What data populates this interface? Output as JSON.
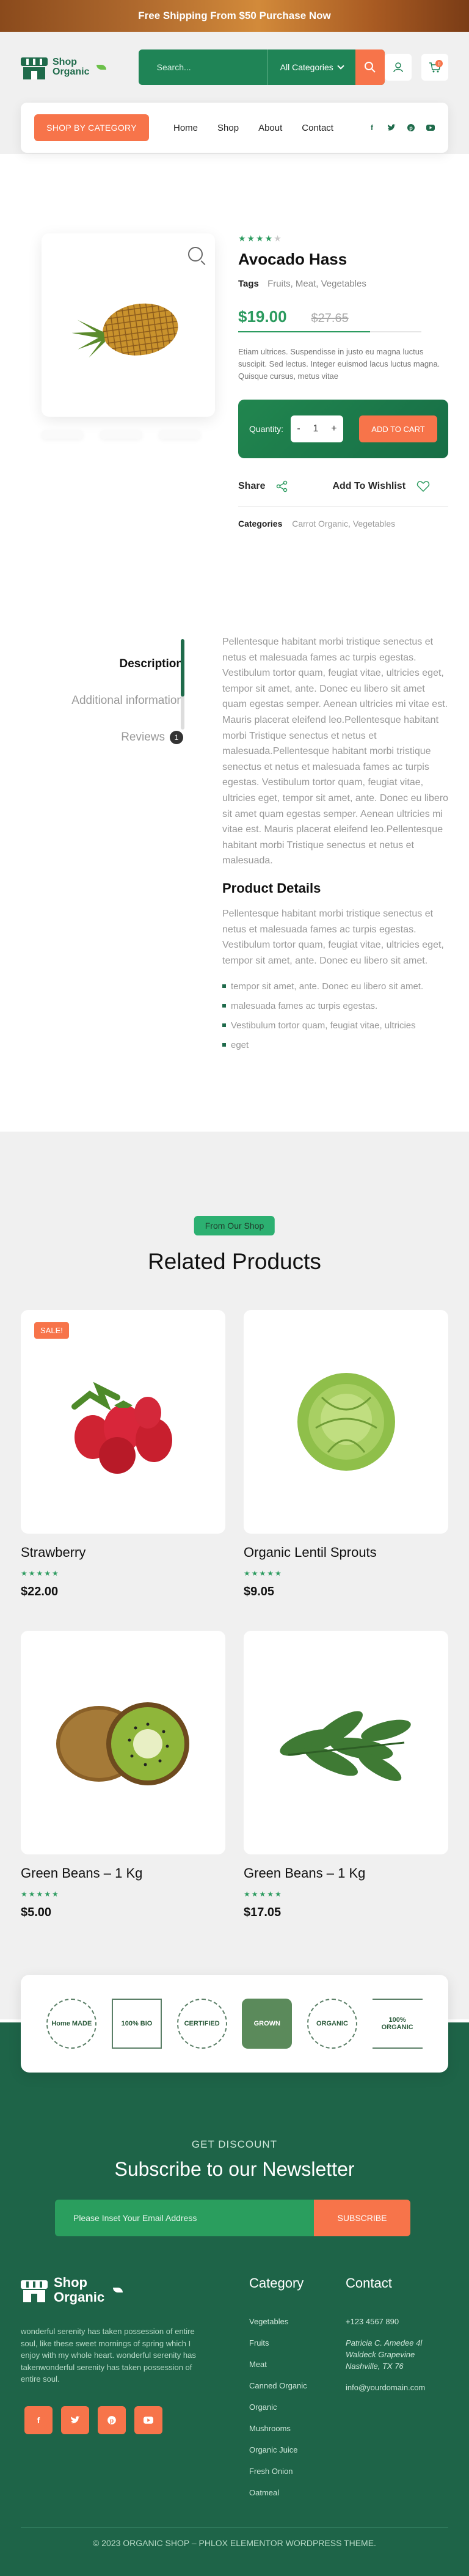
{
  "topbar": {
    "text": "Free Shipping From $50 Purchase Now"
  },
  "header": {
    "logo_line1": "Shop",
    "logo_line2": "Organic",
    "search_placeholder": "Search...",
    "category_select": "All Categories",
    "cart_count": "0"
  },
  "nav": {
    "shop_by_category": "SHOP BY CATEGORY",
    "links": [
      "Home",
      "Shop",
      "About",
      "Contact"
    ],
    "social_icons": [
      "facebook-icon",
      "twitter-icon",
      "pinterest-icon",
      "youtube-icon"
    ]
  },
  "product": {
    "rating": "4",
    "title": "Avocado Hass",
    "tags_label": "Tags",
    "tags": "Fruits, Meat, Vegetables",
    "price": "$19.00",
    "old_price": "$27.65",
    "description": "Etiam ultrices. Suspendisse in justo eu magna luctus suscipit. Sed lectus. Integer euismod lacus luctus magna. Quisque cursus, metus vitae",
    "quantity_label": "Quantity:",
    "quantity_value": "1",
    "add_to_cart": "ADD TO CART",
    "share": "Share",
    "wishlist": "Add To Wishlist",
    "categories_label": "Categories",
    "categories": "Carrot Organic, Vegetables"
  },
  "tabs": {
    "items": [
      "Description",
      "Additional information",
      "Reviews"
    ],
    "review_count": "1",
    "body_p1": "Pellentesque habitant morbi tristique senectus et netus et malesuada fames ac turpis egestas. Vestibulum tortor quam, feugiat vitae, ultricies eget, tempor sit amet, ante. Donec eu libero sit amet quam egestas semper. Aenean ultricies mi vitae est. Mauris placerat eleifend leo.Pellentesque habitant morbi Tristique senectus et netus et malesuada.Pellentesque habitant morbi tristique senectus et netus et malesuada fames ac turpis egestas. Vestibulum tortor quam, feugiat vitae, ultricies eget, tempor sit amet, ante. Donec eu libero sit amet quam egestas semper. Aenean ultricies mi vitae est. Mauris placerat eleifend leo.Pellentesque habitant morbi Tristique senectus et netus et malesuada.",
    "details_title": "Product Details",
    "body_p2": "Pellentesque habitant morbi tristique senectus et netus et malesuada fames ac turpis egestas. Vestibulum tortor quam, feugiat vitae, ultricies eget, tempor sit amet, ante. Donec eu libero sit amet.",
    "bullets": [
      "tempor sit amet, ante. Donec eu libero sit amet.",
      "malesuada fames ac turpis egestas.",
      "Vestibulum tortor quam, feugiat vitae, ultricies",
      "eget"
    ]
  },
  "related": {
    "pill": "From Our Shop",
    "title": "Related Products",
    "products": [
      {
        "name": "Strawberry",
        "price": "$22.00",
        "sale": "SALE!"
      },
      {
        "name": "Organic Lentil Sprouts",
        "price": "$9.05"
      },
      {
        "name": "Green Beans – 1 Kg",
        "price": "$5.00"
      },
      {
        "name": "Green Beans – 1 Kg",
        "price": "$17.05"
      }
    ],
    "rating": "5"
  },
  "badges": [
    "Home MADE",
    "100% BIO",
    "CERTIFIED",
    "GROWN",
    "ORGANIC",
    "100% ORGANIC"
  ],
  "footer": {
    "newsletter_sub": "GET DISCOUNT",
    "newsletter_title": "Subscribe to our Newsletter",
    "email_placeholder": "Please Inset Your Email Address",
    "subscribe": "SUBSCRIBE",
    "logo_line1": "Shop",
    "logo_line2": "Organic",
    "about": "wonderful serenity has taken possession of entire soul, like these sweet mornings of spring which I enjoy with my whole heart. wonderful serenity has takenwonderful serenity has taken possession of entire soul.",
    "category_title": "Category",
    "categories": [
      "Vegetables",
      "Fruits",
      "Meat",
      "Canned Organic",
      "Organic",
      "Mushrooms",
      "Organic Juice",
      "Fresh Onion",
      "Oatmeal"
    ],
    "contact_title": "Contact",
    "phone": "+123 4567 890",
    "address1": "Patricia C. Amedee 4l",
    "address2": "Waldeck Grapevine",
    "address3": "Nashville, TX 76",
    "email": "info@yourdomain.com",
    "copyright": "© 2023 ORGANIC SHOP – PHLOX ELEMENTOR WORDPRESS THEME."
  }
}
